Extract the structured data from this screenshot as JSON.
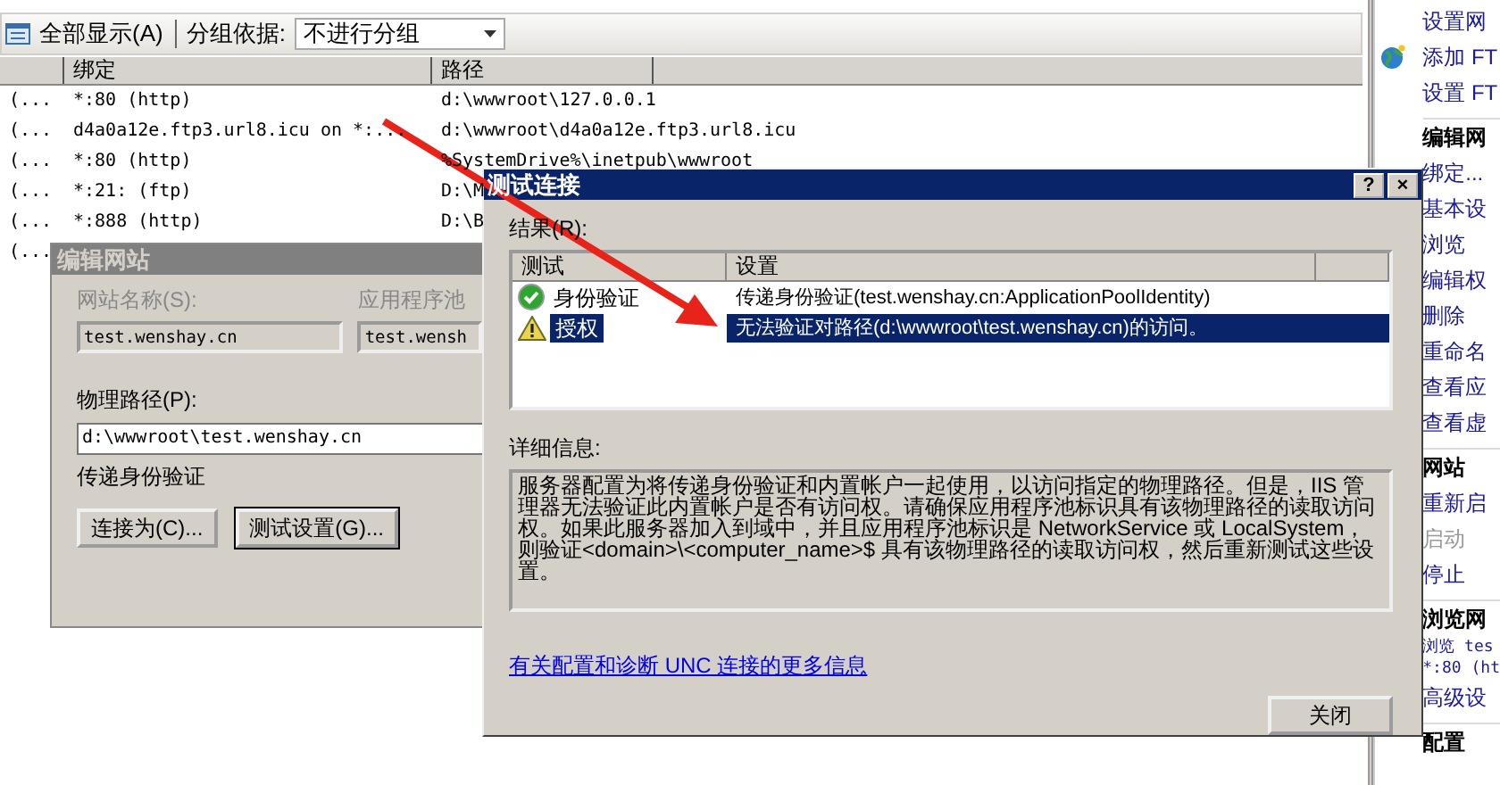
{
  "toolbar": {
    "show_all": "全部显示(A)",
    "group_label": "分组依据:",
    "group_value": "不进行分组"
  },
  "table": {
    "columns": [
      "绑定",
      "路径"
    ],
    "rows": [
      {
        "column_1": "(...",
        "binding": "*:80 (http)",
        "path": "d:\\wwwroot\\127.0.0.1"
      },
      {
        "column_1": "(...",
        "binding": "d4a0a12e.ftp3.url8.icu on *:...",
        "path": "d:\\wwwroot\\d4a0a12e.ftp3.url8.icu"
      },
      {
        "column_1": "(...",
        "binding": "*:80 (http)",
        "path": "%SystemDrive%\\inetpub\\wwwroot"
      },
      {
        "column_1": "(...",
        "binding": "*:21: (ftp)",
        "path": "D:\\M"
      },
      {
        "column_1": "(...",
        "binding": "*:888 (http)",
        "path": "D:\\B"
      },
      {
        "column_1": "(..."
      }
    ]
  },
  "actions": [
    {
      "kind": "link",
      "label": "设置网"
    },
    {
      "kind": "icon_link",
      "label": "添加 FT"
    },
    {
      "kind": "link",
      "label": "设置 FT"
    },
    {
      "kind": "header",
      "label": "编辑网"
    },
    {
      "kind": "link",
      "label": "绑定..."
    },
    {
      "kind": "link",
      "label": "基本设"
    },
    {
      "kind": "link",
      "label": "浏览"
    },
    {
      "kind": "link",
      "label": "编辑权"
    },
    {
      "kind": "link",
      "label": "删除"
    },
    {
      "kind": "link",
      "label": "重命名"
    },
    {
      "kind": "link",
      "label": "查看应"
    },
    {
      "kind": "link",
      "label": "查看虚"
    },
    {
      "kind": "header",
      "label": "网站"
    },
    {
      "kind": "link",
      "label": "重新启"
    },
    {
      "kind": "disabled",
      "label": "启动"
    },
    {
      "kind": "link",
      "label": "停止"
    },
    {
      "kind": "header",
      "label": "浏览网"
    },
    {
      "kind": "small_link",
      "label": "浏览 tes"
    },
    {
      "kind": "small_link",
      "label": "*:80 (ht"
    },
    {
      "kind": "link",
      "label": "高级设"
    },
    {
      "kind": "header",
      "label": "配置"
    }
  ],
  "edit_site_dialog": {
    "title": "编辑网站",
    "fields": [
      {
        "label": "网站名称(S):",
        "value": "test.wenshay.cn",
        "disabled": true
      },
      {
        "label": "应用程序池",
        "value": "test.wensh",
        "disabled": true
      }
    ],
    "physical_path": {
      "label": "物理路径(P):",
      "value": "d:\\wwwroot\\test.wenshay.cn"
    },
    "auth_note": "传递身份验证",
    "buttons": [
      "连接为(C)...",
      "测试设置(G)..."
    ]
  },
  "test_dialog": {
    "title": "测试连接",
    "title_buttons": [
      "?",
      "×"
    ],
    "results_label": "结果(R):",
    "columns": [
      "测试",
      "设置"
    ],
    "results": [
      {
        "kind": "success",
        "test": "身份验证",
        "setting": "传递身份验证(test.wenshay.cn:ApplicationPoolIdentity)",
        "selected": false
      },
      {
        "kind": "warning",
        "test": "授权",
        "setting": "无法验证对路径(d:\\wwwroot\\test.wenshay.cn)的访问。",
        "selected": true
      }
    ],
    "details_label": "详细信息:",
    "details": "服务器配置为将传递身份验证和内置帐户一起使用，以访问指定的物理路径。但是，IIS 管理器无法验证此内置帐户是否有访问权。请确保应用程序池标识具有该物理路径的读取访问权。如果此服务器加入到域中，并且应用程序池标识是 NetworkService 或 LocalSystem，则验证<domain>\\<computer_name>$ 具有该物理路径的读取访问权，然后重新测试这些设置。",
    "link": "有关配置和诊断 UNC 连接的更多信息",
    "close_button": "关闭"
  }
}
